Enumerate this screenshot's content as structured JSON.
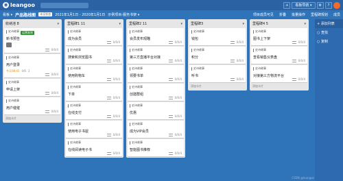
{
  "topbar": {
    "brand": "leangoo",
    "buttons": [
      "+",
      "看板导航 ▾",
      "⚙",
      "?"
    ]
  },
  "subbar": {
    "board_menu": "看板 ▾",
    "board_title": "产品路线图",
    "status_chip": "未设状态",
    "date_range": "2021年1月1日 - 2020年1月1日",
    "project": "示例项目-服务书架 ▾",
    "right_links": [
      "项目成员可见",
      "折叠",
      "批量操作",
      "显示方案",
      "里程碑规划"
    ],
    "members": "成员"
  },
  "columns": [
    {
      "title": "收纳池",
      "count": "8",
      "cards": [
        {
          "tag": "史诗故事",
          "badge": "运营准则",
          "text": "新书预告",
          "meta": "0/0/4",
          "extra": "box"
        },
        {
          "tag": "史诗故事",
          "text": "用户登录",
          "meta": "0/0/4",
          "date": "今天08:45",
          "comments": "0/6",
          "count": "2"
        },
        {
          "tag": "史诗故事",
          "text": "申请上架",
          "meta": "0/0/4"
        },
        {
          "tag": "史诗故事",
          "text": "用户催催",
          "meta": "0/0/4"
        }
      ],
      "add_label": "添加卡片"
    },
    {
      "title": "里程碑1",
      "count": "11",
      "cards": [
        {
          "tag": "史诗故事",
          "text": "成为会员",
          "meta": "0/0/4"
        },
        {
          "tag": "史诗故事",
          "text": "搜索和浏览图书",
          "meta": "0/0/4"
        },
        {
          "tag": "史诗故事",
          "text": "使用购物车",
          "meta": "0/0/4"
        },
        {
          "tag": "史诗故事",
          "text": "下单",
          "meta": "0/0/4"
        },
        {
          "tag": "史诗故事",
          "text": "在线支付",
          "meta": "0/0/4"
        },
        {
          "tag": "史诗故事",
          "text": "使用电子书屋",
          "meta": "0/0/4"
        },
        {
          "tag": "史诗故事",
          "text": "在线阅读电子书",
          "meta": "0/0/4"
        }
      ],
      "add_label": "添加卡片"
    },
    {
      "title": "里程碑2",
      "count": "11",
      "cards": [
        {
          "tag": "史诗故事",
          "text": "会员发布观瞄",
          "meta": "0/0/4"
        },
        {
          "tag": "史诗故事",
          "text": "第三方直播平台对接",
          "meta": "0/0/4"
        },
        {
          "tag": "史诗故事",
          "text": "领要书单",
          "meta": "0/0/4"
        },
        {
          "tag": "史诗故事",
          "text": "创建群组",
          "meta": "0/0/4"
        },
        {
          "tag": "史诗故事",
          "text": "优惠",
          "meta": "0/0/4"
        },
        {
          "tag": "史诗故事",
          "text": "成为VIP会员",
          "meta": "0/0/4"
        },
        {
          "tag": "史诗故事",
          "text": "智能图书推荐",
          "meta": "0/0/4"
        }
      ],
      "add_label": "添加卡片"
    },
    {
      "title": "里程碑3",
      "count": "",
      "cards": [
        {
          "tag": "史诗故事",
          "text": "钱包",
          "meta": "0/0/4"
        },
        {
          "tag": "史诗故事",
          "text": "积分",
          "meta": "0/0/4"
        },
        {
          "tag": "史诗故事",
          "text": "听书",
          "meta": "0/0/4"
        }
      ],
      "add_label": "添加卡片"
    },
    {
      "title": "里程碑4",
      "count": "5",
      "cards": [
        {
          "tag": "史诗故事",
          "text": "图书上下架",
          "meta": "0/0/4"
        },
        {
          "tag": "史诗故事",
          "text": "查看销售仪表盘",
          "meta": "0/0/4"
        },
        {
          "tag": "史诗故事",
          "text": "对接第三方物流平台",
          "meta": "0/0/4"
        }
      ],
      "add_label": "添加卡片"
    }
  ],
  "sidepanel": {
    "add_list": "添加列表",
    "items": [
      "查找",
      "复制"
    ]
  },
  "watermark": "CSDN @leangoo"
}
